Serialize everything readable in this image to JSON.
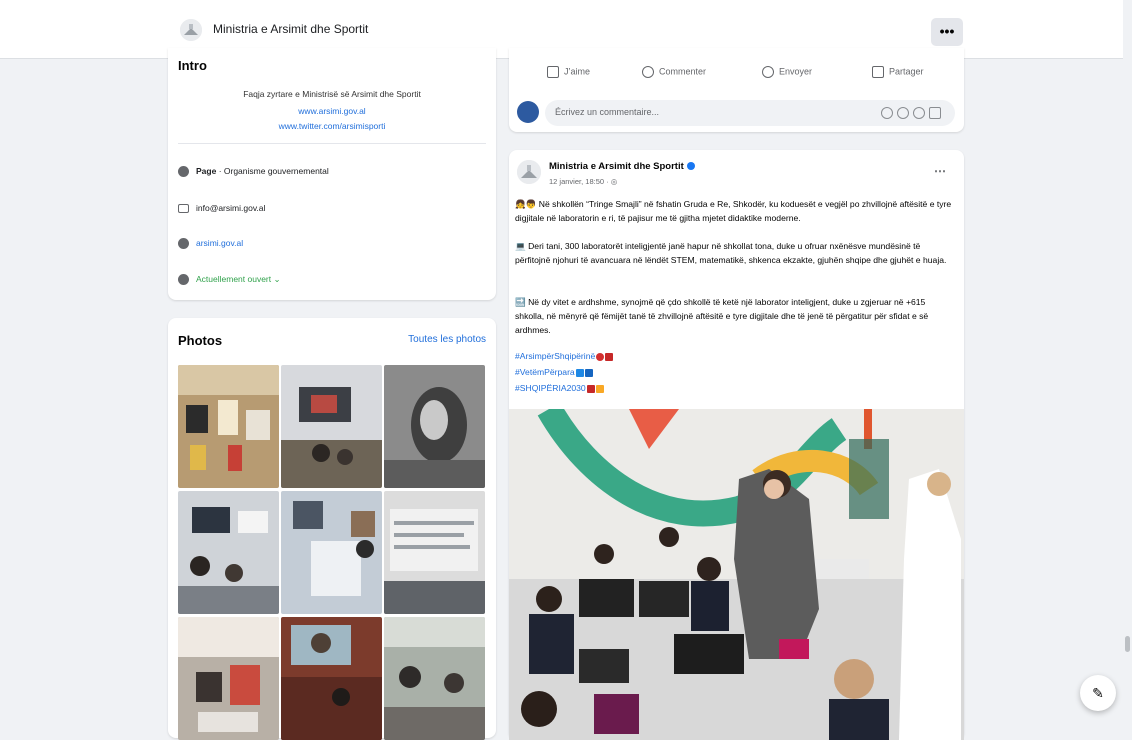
{
  "header": {
    "page_name": "Ministria e Arsimit dhe Sportit",
    "more_label": "•••"
  },
  "intro": {
    "title": "Intro",
    "description": "Faqja zyrtare e Ministrisë së Arsimit dhe Sportit",
    "links": [
      "www.arsimi.gov.al",
      "www.twitter.com/arsimisporti"
    ],
    "category_label": "Page",
    "category_value": " · Organisme gouvernemental",
    "email": "info@arsimi.gov.al",
    "website": "arsimi.gov.al",
    "status": "Actuellement ouvert ⌄"
  },
  "photos": {
    "title": "Photos",
    "see_all": "Toutes les photos"
  },
  "post_actions": {
    "like": "J’aime",
    "comment": "Commenter",
    "send": "Envoyer",
    "share": "Partager",
    "comment_placeholder": "Écrivez un commentaire..."
  },
  "post": {
    "author": "Ministria e Arsimit dhe Sportit",
    "time": "12 janvier, 18:50 · ◎",
    "paragraphs": [
      "👧👦 Në shkollën “Tringe Smajli” në fshatin Gruda e Re, Shkodër, ku koduesët e vegjël po zhvillojnë aftësitë e tyre digjitale në laboratorin e ri, të pajisur me të gjitha mjetet didaktike moderne.",
      "💻 Deri tani, 300 laboratorët inteligjentë janë hapur në shkollat tona, duke u ofruar nxënësve mundësinë të përfitojnë njohuri të avancuara në lëndët STEM, matematikë, shkenca ekzakte, gjuhën shqipe dhe gjuhët e huaja.",
      "🔜 Në dy vitet e ardhshme, synojmë që çdo shkollë të ketë një laborator inteligjent, duke u zgjeruar në +615 shkolla, në mënyrë që fëmijët tanë të zhvillojnë aftësitë e tyre digjitale dhe të jenë të përgatitur për sfidat e së ardhmes."
    ],
    "hashtags": [
      "#ArsimpërShqipërinë",
      "#VetëmPërpara",
      "#SHQIPËRIA2030"
    ]
  },
  "colors": {
    "link": "#216fdb",
    "background": "#f0f2f5",
    "open_status": "#31a24c",
    "verified": "#1877f2"
  },
  "icons": [
    "info-icon",
    "email-icon",
    "globe-icon",
    "clock-icon",
    "like-icon",
    "comment-icon",
    "whatsapp-icon",
    "share-icon",
    "edit-icon"
  ]
}
